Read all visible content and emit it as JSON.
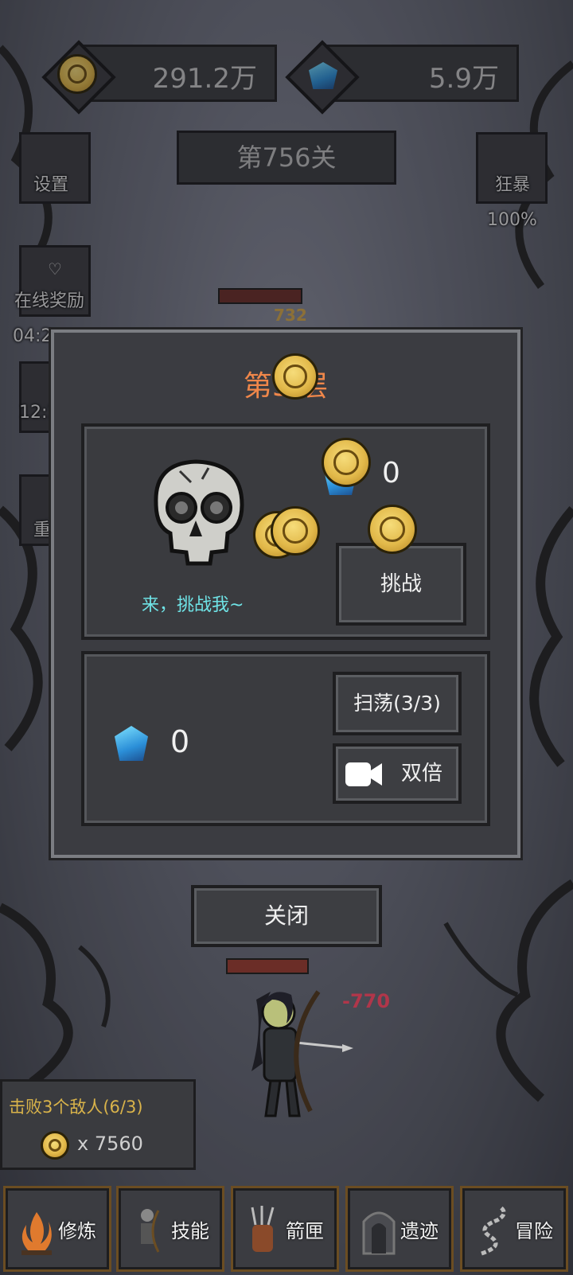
{
  "resources": {
    "gold": "291.2万",
    "gems": "5.9万"
  },
  "level": "第756关",
  "side_left": {
    "settings": "设置",
    "online_reward": "在线奖励",
    "online_timer": "04:2",
    "timer2": "12:1",
    "reset": "重"
  },
  "side_right": {
    "rage": "狂暴",
    "rage_percent": "100%"
  },
  "battle": {
    "enemy_damage": "732",
    "hero_damage": "-770"
  },
  "modal": {
    "title": "第5 层",
    "boss_prompt": "来，挑战我~",
    "reward_amount": "0",
    "challenge_button": "挑战",
    "sweep_button": "扫荡(3/3)",
    "sweep_reward": "0",
    "double_button": "双倍"
  },
  "close_button": "关闭",
  "quest": {
    "text": "击败3个敌人(6/3)",
    "reward": "x 7560"
  },
  "nav": [
    {
      "label": "修炼"
    },
    {
      "label": "技能"
    },
    {
      "label": "箭匣"
    },
    {
      "label": "遗迹"
    },
    {
      "label": "冒险"
    }
  ],
  "colors": {
    "modal_title": "#f0874a",
    "prompt_text": "#6fe3e6",
    "quest_text": "#d9b34a"
  }
}
